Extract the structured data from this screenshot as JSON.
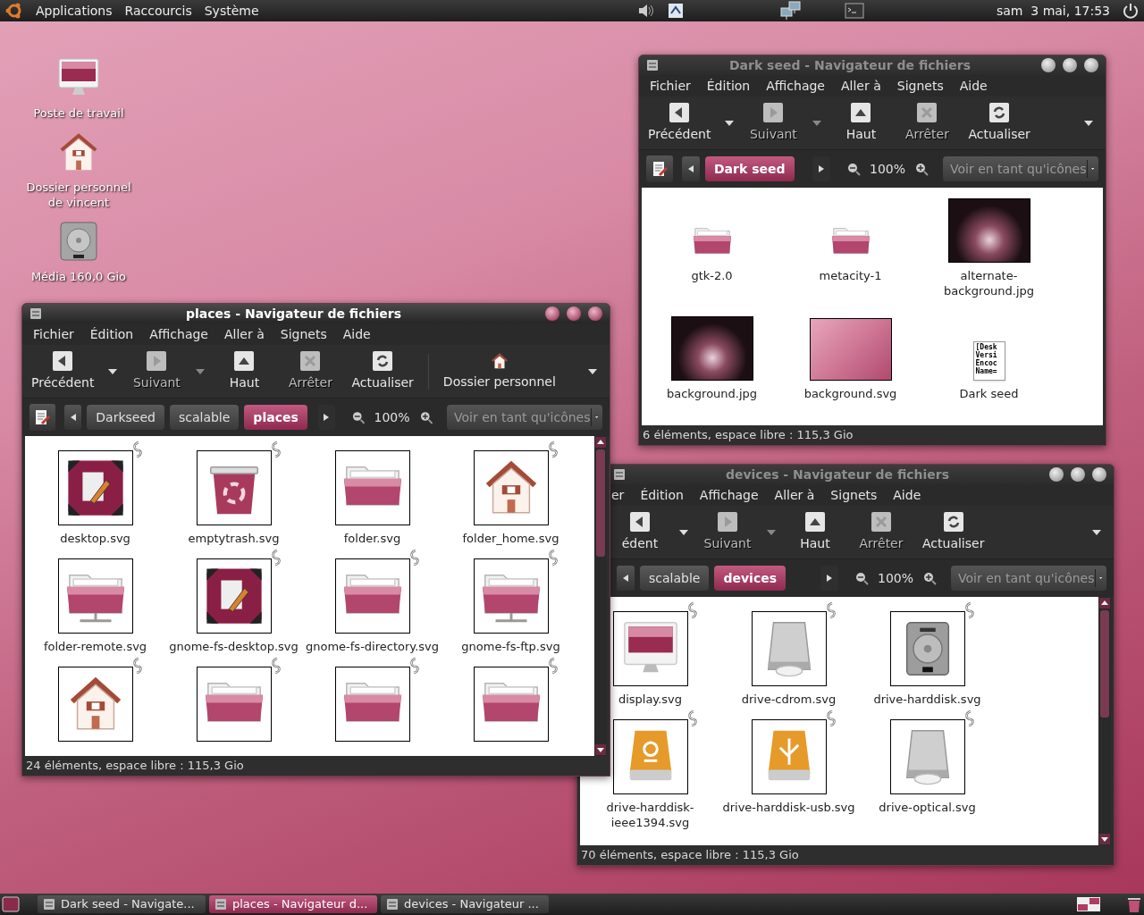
{
  "top_panel": {
    "menus": [
      "Applications",
      "Raccourcis",
      "Système"
    ],
    "clock": "sam  3 mai, 17:53"
  },
  "desktop_icons": [
    {
      "kind": "computer",
      "label": "Poste de travail"
    },
    {
      "kind": "home",
      "label": "Dossier personnel de vincent"
    },
    {
      "kind": "disk",
      "label": "Média 160,0 Gio"
    }
  ],
  "windows": [
    {
      "title": "Dark seed - Navigateur de fichiers",
      "active": false,
      "menus": [
        "Fichier",
        "Édition",
        "Affichage",
        "Aller à",
        "Signets",
        "Aide"
      ],
      "toolbar": [
        {
          "kind": "back",
          "label": "Précédent",
          "disabled": false,
          "dropdown": true
        },
        {
          "kind": "forward",
          "label": "Suivant",
          "disabled": true,
          "dropdown": true
        },
        {
          "kind": "up",
          "label": "Haut",
          "disabled": false,
          "dropdown": false
        },
        {
          "kind": "stop",
          "label": "Arrêter",
          "disabled": true,
          "dropdown": false
        },
        {
          "kind": "reload",
          "label": "Actualiser",
          "disabled": false,
          "dropdown": false
        }
      ],
      "path": [
        {
          "label": "Dark seed",
          "selected": true
        }
      ],
      "zoom": "100%",
      "view": "Voir en tant qu'icônes",
      "thumbnails": false,
      "scrollbar": false,
      "files": [
        {
          "kind": "folder",
          "name": "gtk-2.0"
        },
        {
          "kind": "folder",
          "name": "metacity-1"
        },
        {
          "kind": "photo",
          "name": "alternate-background.jpg"
        },
        {
          "kind": "photo",
          "name": "background.jpg"
        },
        {
          "kind": "wallpaper",
          "name": "background.svg"
        },
        {
          "kind": "text-doc",
          "name": "Dark seed",
          "preview": [
            "[Desk",
            "Versi",
            "Encoc",
            "Name="
          ]
        }
      ],
      "status": "6 éléments, espace libre : 115,3 Gio"
    },
    {
      "title": "places - Navigateur de fichiers",
      "active": true,
      "menus": [
        "Fichier",
        "Édition",
        "Affichage",
        "Aller à",
        "Signets",
        "Aide"
      ],
      "toolbar": [
        {
          "kind": "back",
          "label": "Précédent",
          "disabled": false,
          "dropdown": true
        },
        {
          "kind": "forward",
          "label": "Suivant",
          "disabled": true,
          "dropdown": true
        },
        {
          "kind": "up",
          "label": "Haut",
          "disabled": false,
          "dropdown": false
        },
        {
          "kind": "stop",
          "label": "Arrêter",
          "disabled": true,
          "dropdown": false
        },
        {
          "kind": "reload",
          "label": "Actualiser",
          "disabled": false,
          "dropdown": false
        },
        {
          "kind": "home",
          "label": "Dossier personnel",
          "disabled": false,
          "dropdown": false
        }
      ],
      "path": [
        {
          "label": "Darkseed",
          "selected": false
        },
        {
          "label": "scalable",
          "selected": false
        },
        {
          "label": "places",
          "selected": true
        }
      ],
      "zoom": "100%",
      "view": "Voir en tant qu'icônes",
      "thumbnails": true,
      "scrollbar": true,
      "files": [
        {
          "kind": "desktop",
          "name": "desktop.svg",
          "emblem": true
        },
        {
          "kind": "trash",
          "name": "emptytrash.svg",
          "emblem": true
        },
        {
          "kind": "folder",
          "name": "folder.svg",
          "emblem": false
        },
        {
          "kind": "home",
          "name": "folder_home.svg",
          "emblem": true
        },
        {
          "kind": "remote-folder",
          "name": "folder-remote.svg",
          "emblem": false
        },
        {
          "kind": "desktop",
          "name": "gnome-fs-desktop.svg",
          "emblem": true
        },
        {
          "kind": "folder",
          "name": "gnome-fs-directory.svg",
          "emblem": true
        },
        {
          "kind": "remote-folder",
          "name": "gnome-fs-ftp.svg",
          "emblem": true
        },
        {
          "kind": "home",
          "emblem": true
        },
        {
          "kind": "folder",
          "emblem": true
        },
        {
          "kind": "folder",
          "emblem": true
        },
        {
          "kind": "folder",
          "emblem": true
        }
      ],
      "status": "24 éléments, espace libre : 115,3 Gio"
    },
    {
      "title": "devices - Navigateur de fichiers",
      "active": false,
      "menus": [
        "er",
        "Édition",
        "Affichage",
        "Aller à",
        "Signets",
        "Aide"
      ],
      "toolbar": [
        {
          "kind": "back",
          "label": "édent",
          "disabled": false,
          "dropdown": true
        },
        {
          "kind": "forward",
          "label": "Suivant",
          "disabled": true,
          "dropdown": true
        },
        {
          "kind": "up",
          "label": "Haut",
          "disabled": false,
          "dropdown": false
        },
        {
          "kind": "stop",
          "label": "Arrêter",
          "disabled": true,
          "dropdown": false
        },
        {
          "kind": "reload",
          "label": "Actualiser",
          "disabled": false,
          "dropdown": false
        }
      ],
      "path": [
        {
          "label": "scalable",
          "selected": false
        },
        {
          "label": "devices",
          "selected": true
        }
      ],
      "zoom": "100%",
      "view": "Voir en tant qu'icônes",
      "thumbnails": true,
      "scrollbar": true,
      "files": [
        {
          "kind": "display",
          "name": "display.svg",
          "emblem": true
        },
        {
          "kind": "cdrom",
          "name": "drive-cdrom.svg",
          "emblem": true
        },
        {
          "kind": "harddisk",
          "name": "drive-harddisk.svg",
          "emblem": true
        },
        {
          "kind": "firewire",
          "name": "drive-harddisk-ieee1394.svg",
          "emblem": true
        },
        {
          "kind": "usb",
          "name": "drive-harddisk-usb.svg",
          "emblem": true
        },
        {
          "kind": "cdrom",
          "name": "drive-optical.svg",
          "emblem": true
        }
      ],
      "status": "70 éléments, espace libre : 115,3 Gio"
    }
  ],
  "taskbar": [
    {
      "label": "Dark seed - Navigate...",
      "selected": false
    },
    {
      "label": "places - Navigateur d...",
      "selected": true
    },
    {
      "label": "devices - Navigateur ...",
      "selected": false
    }
  ]
}
